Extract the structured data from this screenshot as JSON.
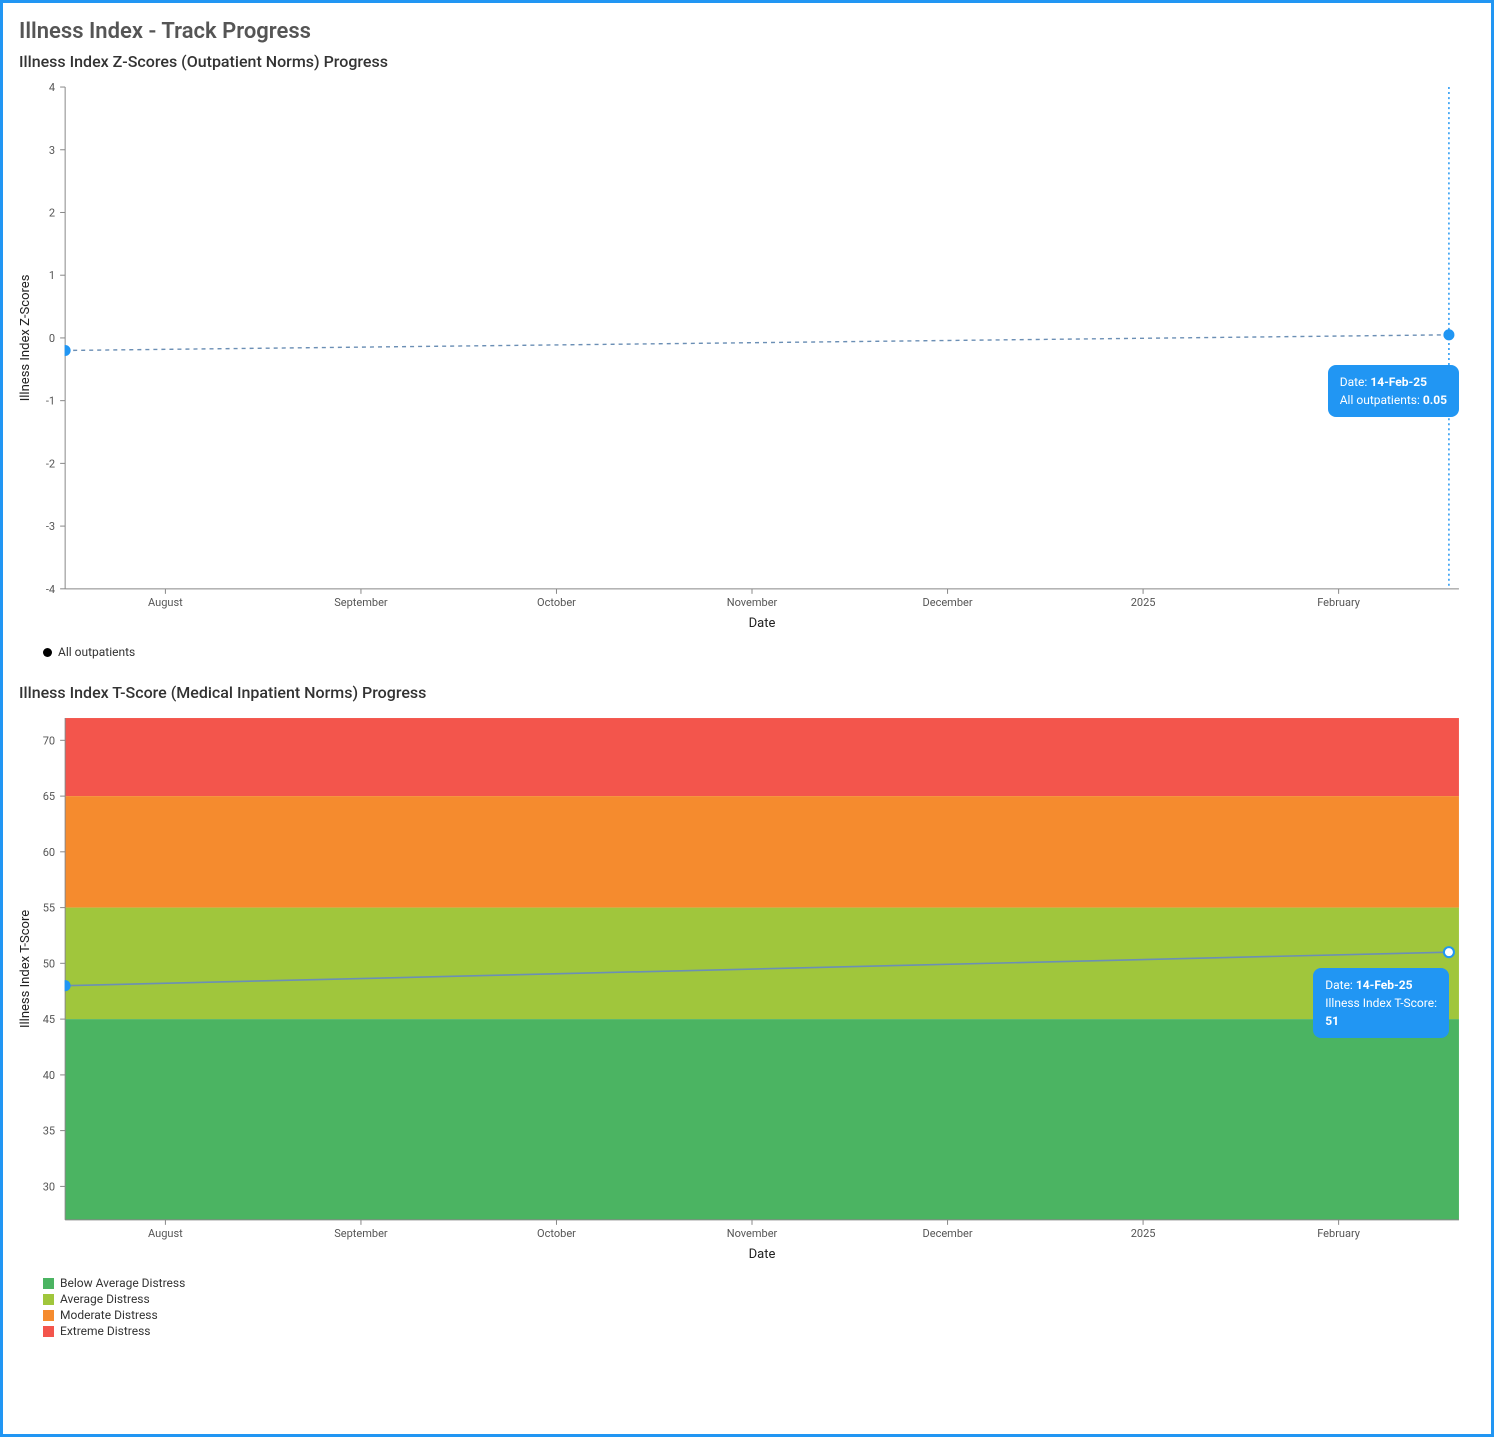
{
  "page_title": "Illness Index - Track Progress",
  "chart1": {
    "title": "Illness Index Z-Scores (Outpatient Norms) Progress",
    "xlabel": "Date",
    "ylabel": "Illness Index Z-Scores",
    "legend": "All outpatients",
    "tooltip": {
      "date_label": "Date:",
      "date_value": "14-Feb-25",
      "metric_label": "All outpatients:",
      "metric_value": "0.05"
    }
  },
  "chart2": {
    "title": "Illness Index T-Score (Medical Inpatient Norms) Progress",
    "xlabel": "Date",
    "ylabel": "Illness Index T-Score",
    "legend": {
      "below": "Below Average Distress",
      "average": "Average Distress",
      "moderate": "Moderate Distress",
      "extreme": "Extreme Distress"
    },
    "tooltip": {
      "date_label": "Date:",
      "date_value": "14-Feb-25",
      "metric_label": "Illness Index T-Score:",
      "metric_value": "51"
    }
  },
  "y_ticks_z": [
    "-4",
    "-3",
    "-2",
    "-1",
    "0",
    "1",
    "2",
    "3",
    "4"
  ],
  "y_ticks_t": [
    "30",
    "35",
    "40",
    "45",
    "50",
    "55",
    "60",
    "65",
    "70"
  ],
  "x_ticks": [
    "August",
    "September",
    "October",
    "November",
    "December",
    "2025",
    "February"
  ],
  "chart_data": [
    {
      "type": "line",
      "title": "Illness Index Z-Scores (Outpatient Norms) Progress",
      "xlabel": "Date",
      "ylabel": "Illness Index Z-Scores",
      "x_ticks": [
        "August",
        "September",
        "October",
        "November",
        "December",
        "2025",
        "February"
      ],
      "ylim": [
        -4,
        4
      ],
      "series": [
        {
          "name": "All outpatients",
          "x": [
            "2024-07-15",
            "2025-02-14"
          ],
          "values": [
            -0.2,
            0.05
          ]
        }
      ]
    },
    {
      "type": "line",
      "title": "Illness Index T-Score (Medical Inpatient Norms) Progress",
      "xlabel": "Date",
      "ylabel": "Illness Index T-Score",
      "x_ticks": [
        "August",
        "September",
        "October",
        "November",
        "December",
        "2025",
        "February"
      ],
      "ylim": [
        27,
        72
      ],
      "bands": [
        {
          "name": "Below Average Distress",
          "from": 27,
          "to": 45,
          "color": "#4bb462"
        },
        {
          "name": "Average Distress",
          "from": 45,
          "to": 55,
          "color": "#a0c63c"
        },
        {
          "name": "Moderate Distress",
          "from": 55,
          "to": 65,
          "color": "#f58b2e"
        },
        {
          "name": "Extreme Distress",
          "from": 65,
          "to": 72,
          "color": "#f3554c"
        }
      ],
      "series": [
        {
          "name": "Illness Index T-Score",
          "x": [
            "2024-07-15",
            "2025-02-14"
          ],
          "values": [
            48,
            51
          ]
        }
      ]
    }
  ]
}
